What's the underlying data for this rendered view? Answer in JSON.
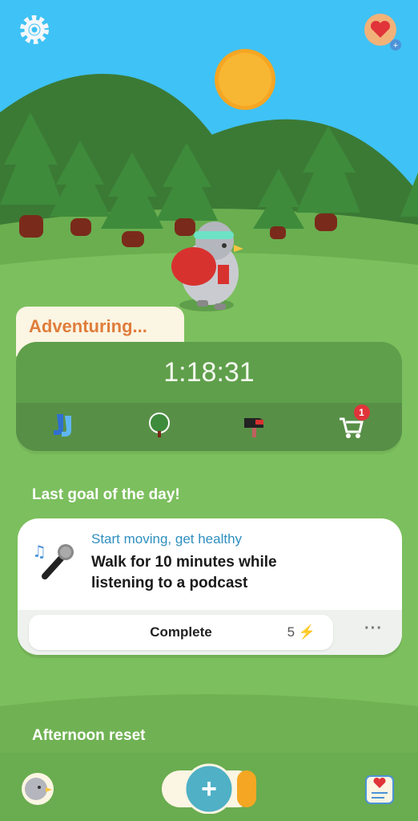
{
  "colors": {
    "sky": "#3fc2f5",
    "hill_dark": "#3b7a35",
    "grass": "#7cbf5e",
    "accent": "#e07d3b"
  },
  "header": {
    "settings_icon": "gear-icon",
    "health_icon": "heart-icon"
  },
  "status": {
    "label": "Adventuring..."
  },
  "timer": {
    "value": "1:18:31",
    "icons": [
      "socks-icon",
      "tree-icon",
      "mailbox-icon",
      "shop-cart-icon"
    ],
    "cart_badge": "1"
  },
  "goals": {
    "section_title": "Last goal of the day!",
    "card": {
      "category": "Start moving, get healthy",
      "title": "Walk for 10 minutes while listening to a podcast",
      "complete_label": "Complete",
      "points": "5",
      "points_icon": "lightning-icon",
      "more_label": "···"
    }
  },
  "next_section": {
    "title": "Afternoon reset"
  },
  "bottom_nav": {
    "add_label": "+",
    "left_icon": "bird-avatar-icon",
    "right_icon": "journal-icon"
  }
}
